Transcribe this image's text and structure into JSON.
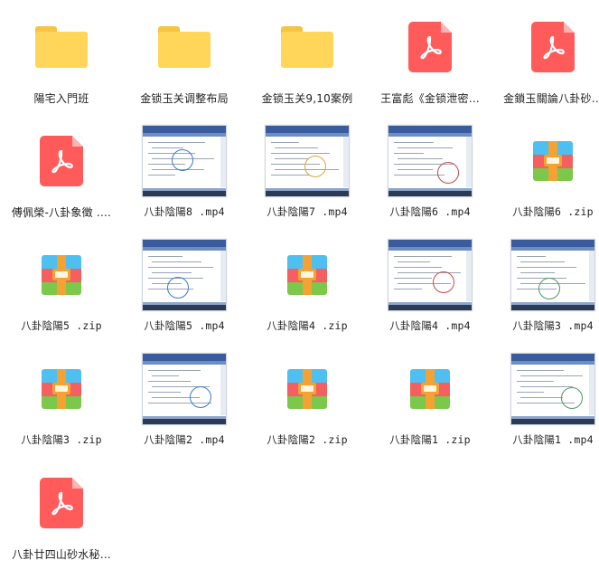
{
  "items": [
    {
      "label": "陽宅入門班",
      "type": "folder",
      "icon": "folder-icon"
    },
    {
      "label": "金锁玉关调整布局",
      "type": "folder",
      "icon": "folder-icon"
    },
    {
      "label": "金锁玉关9,10案例",
      "type": "folder",
      "icon": "folder-icon"
    },
    {
      "label": "王富彪《金锁泄密…",
      "type": "pdf",
      "icon": "pdf-icon"
    },
    {
      "label": "金鎖玉關論八卦砂…",
      "type": "pdf",
      "icon": "pdf-icon"
    },
    {
      "label": "傅佩榮-八卦象徵 .…",
      "type": "pdf",
      "icon": "pdf-icon"
    },
    {
      "label": "八卦陰陽8 .mp4",
      "type": "video",
      "icon": "video-thumbnail"
    },
    {
      "label": "八卦陰陽7 .mp4",
      "type": "video",
      "icon": "video-thumbnail"
    },
    {
      "label": "八卦陰陽6 .mp4",
      "type": "video",
      "icon": "video-thumbnail"
    },
    {
      "label": "八卦陰陽6 .zip",
      "type": "zip",
      "icon": "zip-icon"
    },
    {
      "label": "八卦陰陽5 .zip",
      "type": "zip",
      "icon": "zip-icon"
    },
    {
      "label": "八卦陰陽5 .mp4",
      "type": "video",
      "icon": "video-thumbnail"
    },
    {
      "label": "八卦陰陽4 .zip",
      "type": "zip",
      "icon": "zip-icon"
    },
    {
      "label": "八卦陰陽4 .mp4",
      "type": "video",
      "icon": "video-thumbnail"
    },
    {
      "label": "八卦陰陽3 .mp4",
      "type": "video",
      "icon": "video-thumbnail"
    },
    {
      "label": "八卦陰陽3 .zip",
      "type": "zip",
      "icon": "zip-icon"
    },
    {
      "label": "八卦陰陽2 .mp4",
      "type": "video",
      "icon": "video-thumbnail"
    },
    {
      "label": "八卦陰陽2 .zip",
      "type": "zip",
      "icon": "zip-icon"
    },
    {
      "label": "八卦陰陽1 .zip",
      "type": "zip",
      "icon": "zip-icon"
    },
    {
      "label": "八卦陰陽1 .mp4",
      "type": "video",
      "icon": "video-thumbnail"
    },
    {
      "label": "八卦廿四山砂水秘…",
      "type": "pdf",
      "icon": "pdf-icon"
    }
  ],
  "colors": {
    "folder": "#ffd55a",
    "pdf": "#ff5b5b",
    "zip_blue": "#4dbff0",
    "zip_red": "#f55f5f",
    "zip_green": "#7cc84a",
    "zip_strap": "#f4a234"
  }
}
